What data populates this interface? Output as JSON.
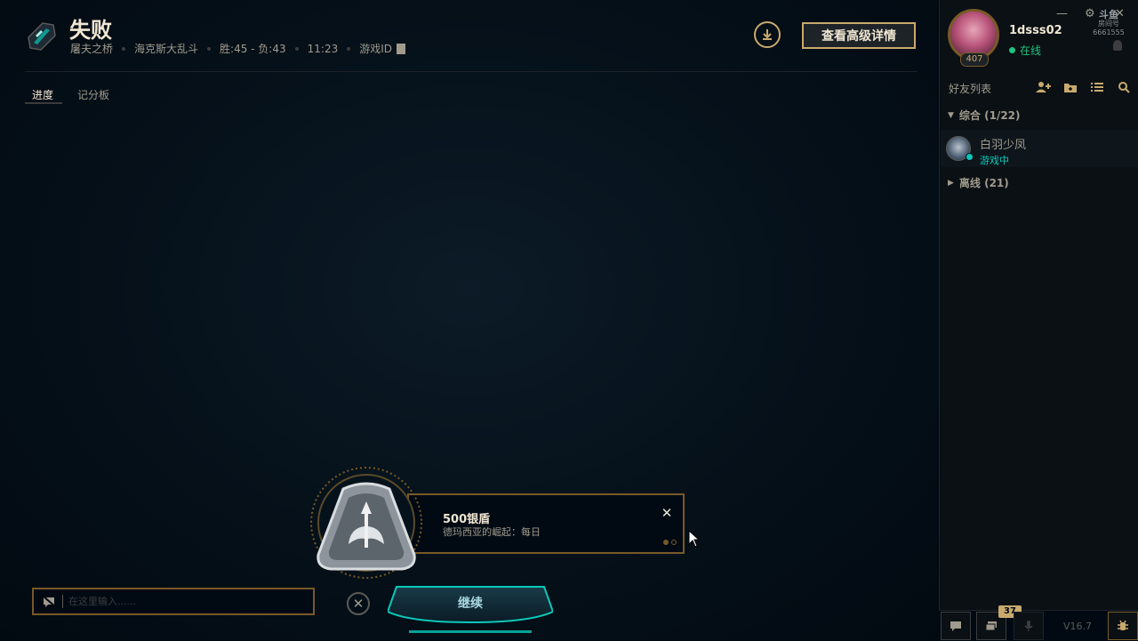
{
  "header": {
    "result": "失败",
    "map": "屠夫之桥",
    "mode": "海克斯大乱斗",
    "record": "胜:45 - 负:43",
    "duration": "11:23",
    "game_id_label": "游戏ID",
    "advanced_button": "查看高级详情"
  },
  "tabs": [
    {
      "label": "进度",
      "active": true
    },
    {
      "label": "记分板",
      "active": false
    }
  ],
  "reward": {
    "title": "500银盾",
    "subtitle": "德玛西亚的崛起：每日",
    "pages": 2,
    "current_page": 1
  },
  "chat": {
    "placeholder": "在这里输入......"
  },
  "continue_label": "继续",
  "profile": {
    "username": "1dsss02",
    "status": "在线",
    "level": "407"
  },
  "watermark": {
    "line1": "斗鱼",
    "line2": "房间号",
    "line3": "6661555"
  },
  "friends": {
    "header": "好友列表",
    "groups": [
      {
        "label": "综合 (1/22)",
        "expanded": true
      },
      {
        "label": "离线 (21)",
        "expanded": false
      }
    ],
    "list": [
      {
        "name": "白羽少凤",
        "status": "游戏中"
      }
    ]
  },
  "bottom": {
    "notification_count": "37",
    "version": "V16.7"
  },
  "colors": {
    "gold": "#c8aa6e",
    "gold_dark": "#785a28",
    "teal": "#0ac8b9",
    "online": "#1ec47e",
    "background": "#010a13"
  }
}
